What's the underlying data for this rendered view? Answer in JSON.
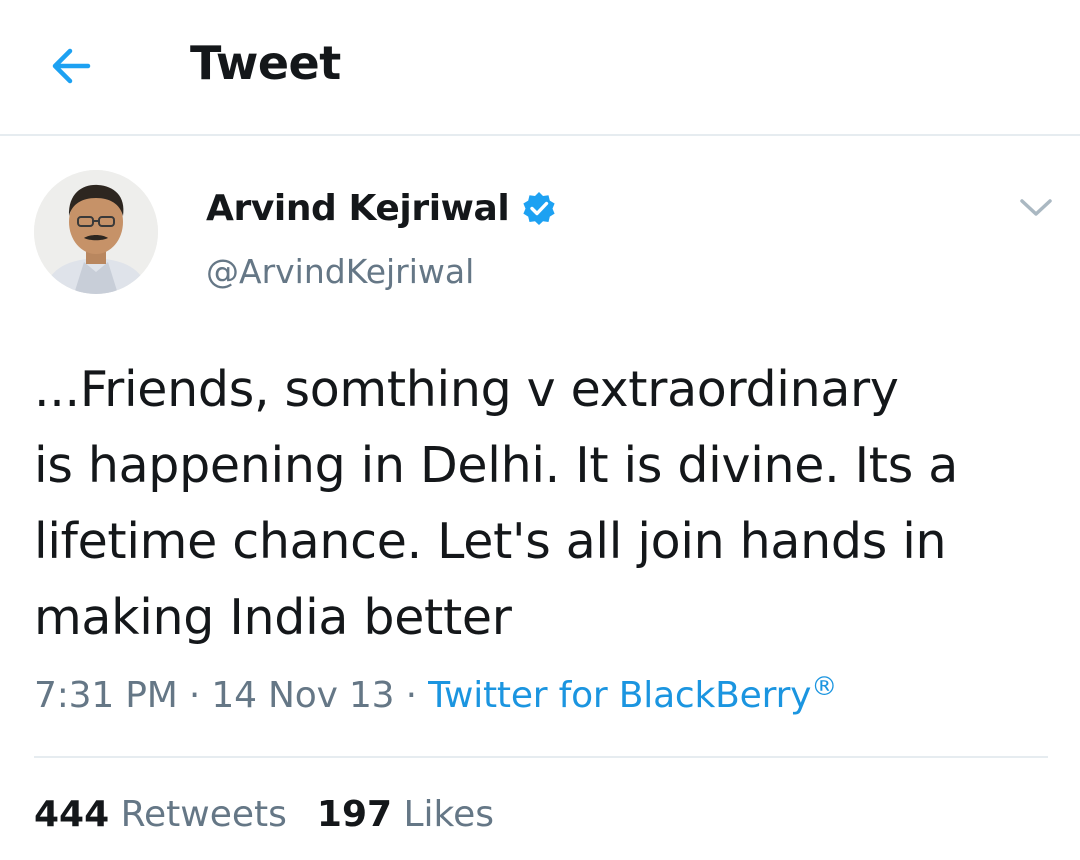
{
  "header": {
    "title": "Tweet",
    "back_icon": "arrow-left-icon"
  },
  "accent_color": "#1da1f2",
  "tweet": {
    "author": {
      "display_name": "Arvind Kejriwal",
      "handle": "@ArvindKejriwal",
      "verified_icon": "verified-badge-icon"
    },
    "menu_icon": "chevron-down-icon",
    "text_lines": [
      "...Friends, somthing v extraordinary",
      "is happening in Delhi. It is divine. Its a",
      "lifetime chance. Let's all join hands in",
      "making India better"
    ],
    "time": "7:31 PM",
    "separator": "·",
    "date": "14 Nov 13",
    "source": "Twitter for BlackBerry",
    "source_mark": "®",
    "retweets_count": "444",
    "retweets_label": "Retweets",
    "likes_count": "197",
    "likes_label": "Likes"
  }
}
